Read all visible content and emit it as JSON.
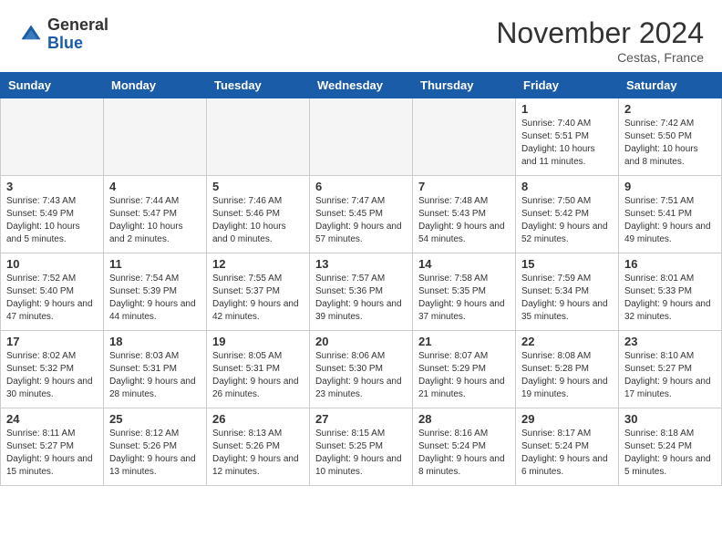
{
  "header": {
    "logo_general": "General",
    "logo_blue": "Blue",
    "month_title": "November 2024",
    "location": "Cestas, France"
  },
  "days_of_week": [
    "Sunday",
    "Monday",
    "Tuesday",
    "Wednesday",
    "Thursday",
    "Friday",
    "Saturday"
  ],
  "weeks": [
    [
      {
        "day": "",
        "info": ""
      },
      {
        "day": "",
        "info": ""
      },
      {
        "day": "",
        "info": ""
      },
      {
        "day": "",
        "info": ""
      },
      {
        "day": "",
        "info": ""
      },
      {
        "day": "1",
        "info": "Sunrise: 7:40 AM\nSunset: 5:51 PM\nDaylight: 10 hours and 11 minutes."
      },
      {
        "day": "2",
        "info": "Sunrise: 7:42 AM\nSunset: 5:50 PM\nDaylight: 10 hours and 8 minutes."
      }
    ],
    [
      {
        "day": "3",
        "info": "Sunrise: 7:43 AM\nSunset: 5:49 PM\nDaylight: 10 hours and 5 minutes."
      },
      {
        "day": "4",
        "info": "Sunrise: 7:44 AM\nSunset: 5:47 PM\nDaylight: 10 hours and 2 minutes."
      },
      {
        "day": "5",
        "info": "Sunrise: 7:46 AM\nSunset: 5:46 PM\nDaylight: 10 hours and 0 minutes."
      },
      {
        "day": "6",
        "info": "Sunrise: 7:47 AM\nSunset: 5:45 PM\nDaylight: 9 hours and 57 minutes."
      },
      {
        "day": "7",
        "info": "Sunrise: 7:48 AM\nSunset: 5:43 PM\nDaylight: 9 hours and 54 minutes."
      },
      {
        "day": "8",
        "info": "Sunrise: 7:50 AM\nSunset: 5:42 PM\nDaylight: 9 hours and 52 minutes."
      },
      {
        "day": "9",
        "info": "Sunrise: 7:51 AM\nSunset: 5:41 PM\nDaylight: 9 hours and 49 minutes."
      }
    ],
    [
      {
        "day": "10",
        "info": "Sunrise: 7:52 AM\nSunset: 5:40 PM\nDaylight: 9 hours and 47 minutes."
      },
      {
        "day": "11",
        "info": "Sunrise: 7:54 AM\nSunset: 5:39 PM\nDaylight: 9 hours and 44 minutes."
      },
      {
        "day": "12",
        "info": "Sunrise: 7:55 AM\nSunset: 5:37 PM\nDaylight: 9 hours and 42 minutes."
      },
      {
        "day": "13",
        "info": "Sunrise: 7:57 AM\nSunset: 5:36 PM\nDaylight: 9 hours and 39 minutes."
      },
      {
        "day": "14",
        "info": "Sunrise: 7:58 AM\nSunset: 5:35 PM\nDaylight: 9 hours and 37 minutes."
      },
      {
        "day": "15",
        "info": "Sunrise: 7:59 AM\nSunset: 5:34 PM\nDaylight: 9 hours and 35 minutes."
      },
      {
        "day": "16",
        "info": "Sunrise: 8:01 AM\nSunset: 5:33 PM\nDaylight: 9 hours and 32 minutes."
      }
    ],
    [
      {
        "day": "17",
        "info": "Sunrise: 8:02 AM\nSunset: 5:32 PM\nDaylight: 9 hours and 30 minutes."
      },
      {
        "day": "18",
        "info": "Sunrise: 8:03 AM\nSunset: 5:31 PM\nDaylight: 9 hours and 28 minutes."
      },
      {
        "day": "19",
        "info": "Sunrise: 8:05 AM\nSunset: 5:31 PM\nDaylight: 9 hours and 26 minutes."
      },
      {
        "day": "20",
        "info": "Sunrise: 8:06 AM\nSunset: 5:30 PM\nDaylight: 9 hours and 23 minutes."
      },
      {
        "day": "21",
        "info": "Sunrise: 8:07 AM\nSunset: 5:29 PM\nDaylight: 9 hours and 21 minutes."
      },
      {
        "day": "22",
        "info": "Sunrise: 8:08 AM\nSunset: 5:28 PM\nDaylight: 9 hours and 19 minutes."
      },
      {
        "day": "23",
        "info": "Sunrise: 8:10 AM\nSunset: 5:27 PM\nDaylight: 9 hours and 17 minutes."
      }
    ],
    [
      {
        "day": "24",
        "info": "Sunrise: 8:11 AM\nSunset: 5:27 PM\nDaylight: 9 hours and 15 minutes."
      },
      {
        "day": "25",
        "info": "Sunrise: 8:12 AM\nSunset: 5:26 PM\nDaylight: 9 hours and 13 minutes."
      },
      {
        "day": "26",
        "info": "Sunrise: 8:13 AM\nSunset: 5:26 PM\nDaylight: 9 hours and 12 minutes."
      },
      {
        "day": "27",
        "info": "Sunrise: 8:15 AM\nSunset: 5:25 PM\nDaylight: 9 hours and 10 minutes."
      },
      {
        "day": "28",
        "info": "Sunrise: 8:16 AM\nSunset: 5:24 PM\nDaylight: 9 hours and 8 minutes."
      },
      {
        "day": "29",
        "info": "Sunrise: 8:17 AM\nSunset: 5:24 PM\nDaylight: 9 hours and 6 minutes."
      },
      {
        "day": "30",
        "info": "Sunrise: 8:18 AM\nSunset: 5:24 PM\nDaylight: 9 hours and 5 minutes."
      }
    ]
  ]
}
